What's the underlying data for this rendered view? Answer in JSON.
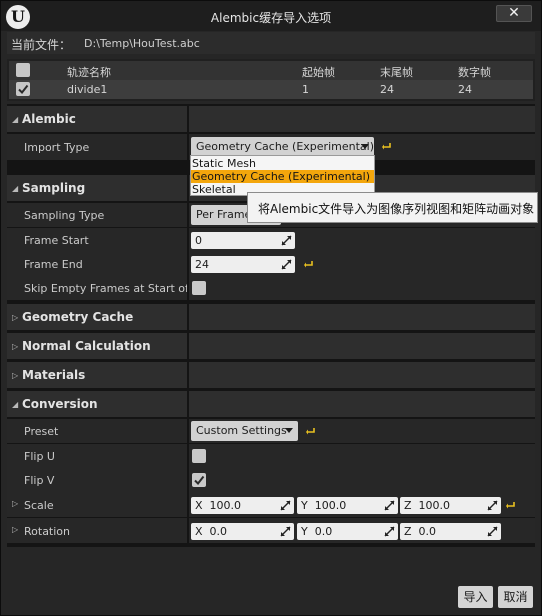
{
  "window": {
    "title": "Alembic缓存导入选项",
    "logo_text": "U",
    "close_glyph": "✕",
    "close_icon": "close-icon",
    "logo_icon": "unreal-logo-icon"
  },
  "current_file": {
    "label": "当前文件：",
    "path": "D:\\Temp\\HouTest.abc"
  },
  "tracks": {
    "headers": [
      "轨迹名称",
      "起始帧",
      "末尾帧",
      "数字帧"
    ],
    "rows": [
      {
        "checked": true,
        "name": "divide1",
        "start": "1",
        "end": "24",
        "frames": "24"
      }
    ]
  },
  "sections": {
    "alembic": {
      "title": "Alembic",
      "import_type": {
        "label": "Import Type",
        "value": "Geometry Cache (Experimental)",
        "options": [
          "Static Mesh",
          "Geometry Cache (Experimental)",
          "Skeletal"
        ],
        "selected_index": 1
      }
    },
    "sampling": {
      "title": "Sampling",
      "sampling_type": {
        "label": "Sampling Type",
        "value": "Per Frame"
      },
      "frame_start": {
        "label": "Frame Start",
        "value": "0"
      },
      "frame_end": {
        "label": "Frame End",
        "value": "24"
      },
      "skip_empty": {
        "label": "Skip Empty Frames at Start of A",
        "checked": false
      }
    },
    "geometry_cache": {
      "title": "Geometry Cache"
    },
    "normal_calculation": {
      "title": "Normal Calculation"
    },
    "materials": {
      "title": "Materials"
    },
    "conversion": {
      "title": "Conversion",
      "preset": {
        "label": "Preset",
        "value": "Custom Settings"
      },
      "flip_u": {
        "label": "Flip U",
        "checked": false
      },
      "flip_v": {
        "label": "Flip V",
        "checked": true
      },
      "scale": {
        "label": "Scale",
        "x_label": "X",
        "x": "100.0",
        "y_label": "Y",
        "y": "100.0",
        "z_label": "Z",
        "z": "100.0"
      },
      "rotation": {
        "label": "Rotation",
        "x_label": "X",
        "x": "0.0",
        "y_label": "Y",
        "y": "0.0",
        "z_label": "Z",
        "z": "0.0"
      }
    }
  },
  "tooltip": {
    "text": "将Alembic文件导入为图像序列视图和矩阵动画对象"
  },
  "buttons": {
    "import": "导入",
    "cancel": "取消"
  },
  "colors": {
    "accent": "#f3a60c",
    "reset_arrow": "#e8c020"
  }
}
